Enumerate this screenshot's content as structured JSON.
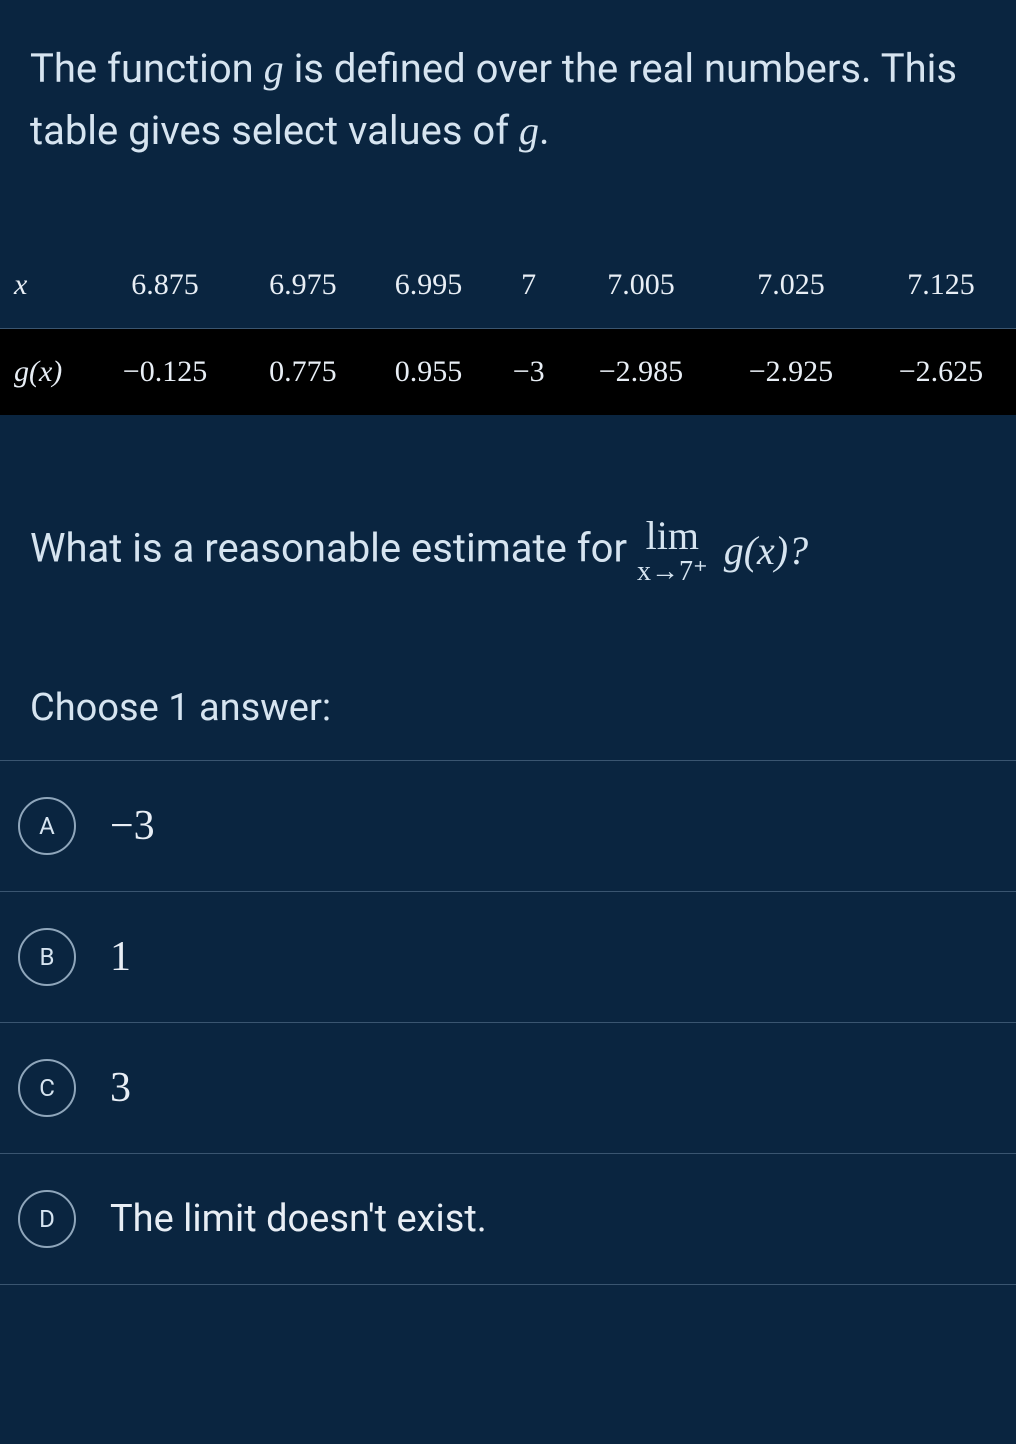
{
  "stem": {
    "part1": "The function ",
    "g": "g",
    "part2": " is defined over the real numbers. This table gives select values of ",
    "g2": "g",
    "part3": "."
  },
  "table": {
    "row1_label": "x",
    "row2_label": "g(x)",
    "x_values": [
      "6.875",
      "6.975",
      "6.995",
      "7",
      "7.005",
      "7.025",
      "7.125"
    ],
    "g_values": [
      "−0.125",
      "0.775",
      "0.955",
      "−3",
      "−2.985",
      "−2.925",
      "−2.625"
    ]
  },
  "question": {
    "lead": "What is a reasonable estimate for ",
    "lim_top": "lim",
    "lim_bot": "x→7⁺",
    "gx": "g(x)?",
    "tail": ""
  },
  "choose_label": "Choose 1 answer:",
  "choices": [
    {
      "letter": "A",
      "text": "−3",
      "math": true
    },
    {
      "letter": "B",
      "text": "1",
      "math": true
    },
    {
      "letter": "C",
      "text": "3",
      "math": true
    },
    {
      "letter": "D",
      "text": "The limit doesn't exist.",
      "math": false
    }
  ]
}
